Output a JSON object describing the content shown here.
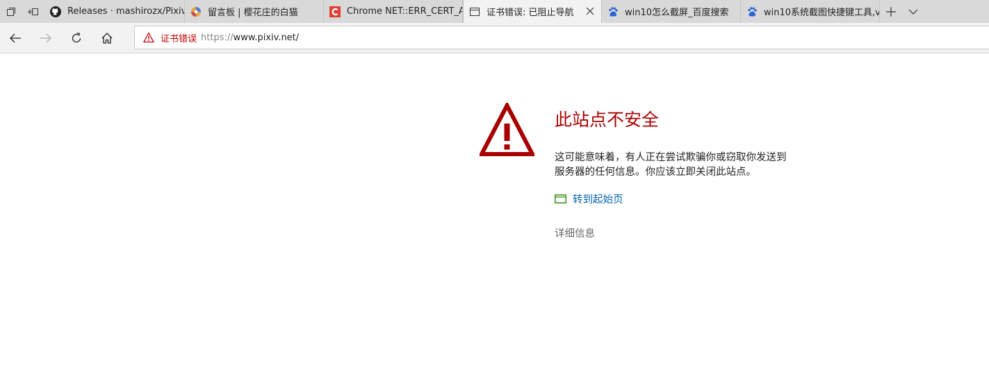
{
  "tabs": [
    {
      "title": "Releases · mashirozx/Pixiv-N",
      "icon": "github-icon",
      "active": false
    },
    {
      "title": "留言板 | 樱花庄的白猫",
      "icon": "site-favicon-icon",
      "active": false
    },
    {
      "title": "Chrome NET::ERR_CERT_AU",
      "icon": "csdn-icon",
      "active": false
    },
    {
      "title": "证书错误: 已阻止导航",
      "icon": "page-icon",
      "active": true
    },
    {
      "title": "win10怎么截屏_百度搜索",
      "icon": "baidu-paw-icon",
      "active": false
    },
    {
      "title": "win10系统截图快捷键工具,v",
      "icon": "baidu-paw-icon",
      "active": false
    }
  ],
  "address_bar": {
    "cert_error_label": "证书错误",
    "url_scheme": "https://",
    "url_rest": "www.pixiv.net/"
  },
  "page": {
    "headline": "此站点不安全",
    "message": "这可能意味着，有人正在尝试欺骗你或窃取你发送到服务器的任何信息。你应该立即关闭此站点。",
    "go_to_start_label": "转到起始页",
    "details_label": "详细信息"
  },
  "colors": {
    "warning_red": "#a80000",
    "link_blue": "#0063b1",
    "start_icon_green": "#3a8e1a"
  }
}
